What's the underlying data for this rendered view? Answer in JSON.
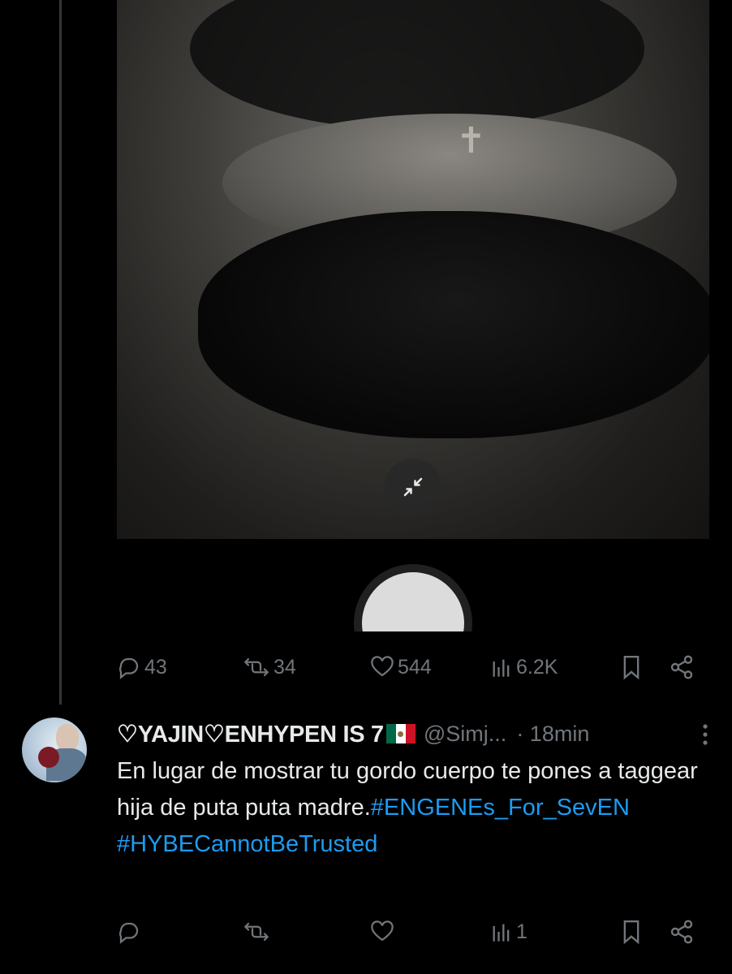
{
  "original_tweet": {
    "media": {
      "collapse_icon": "collapse-arrows-icon"
    },
    "actions": {
      "replies": "43",
      "retweets": "34",
      "likes": "544",
      "views": "6.2K"
    }
  },
  "reply": {
    "display_name": "♡YAJIN♡ENHYPEN IS 7",
    "handle": "@Simj...",
    "time": "· 18min",
    "text_plain": "En lugar de mostrar tu gordo cuerpo te pones a taggear hija de puta puta madre.",
    "hashtags": [
      "#ENGENEs_For_SevEN",
      "#HYBECannotBeTrusted"
    ],
    "actions": {
      "replies": "",
      "retweets": "",
      "likes": "",
      "views": "1"
    }
  },
  "colors": {
    "background": "#000000",
    "muted": "#71767b",
    "text": "#e7e9ea",
    "link": "#1d9bf0"
  }
}
